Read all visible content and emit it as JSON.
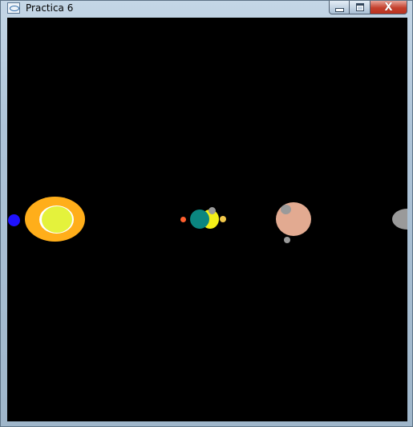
{
  "window": {
    "title": "Practica 6",
    "controls": {
      "minimize": "–",
      "maximize": "□",
      "close": "X"
    }
  },
  "scene": {
    "background": "#000000",
    "colors": {
      "blue": "#1f12ff",
      "orange_ring": "#ffae1a",
      "yellow_green": "#e4f23c",
      "white": "#ffffff",
      "teal": "#0b8680",
      "yellow": "#f4ef18",
      "gray": "#9a9a9a",
      "red_orange": "#ff5f2e",
      "gold": "#f2c84a",
      "peach": "#e2aa91"
    }
  }
}
